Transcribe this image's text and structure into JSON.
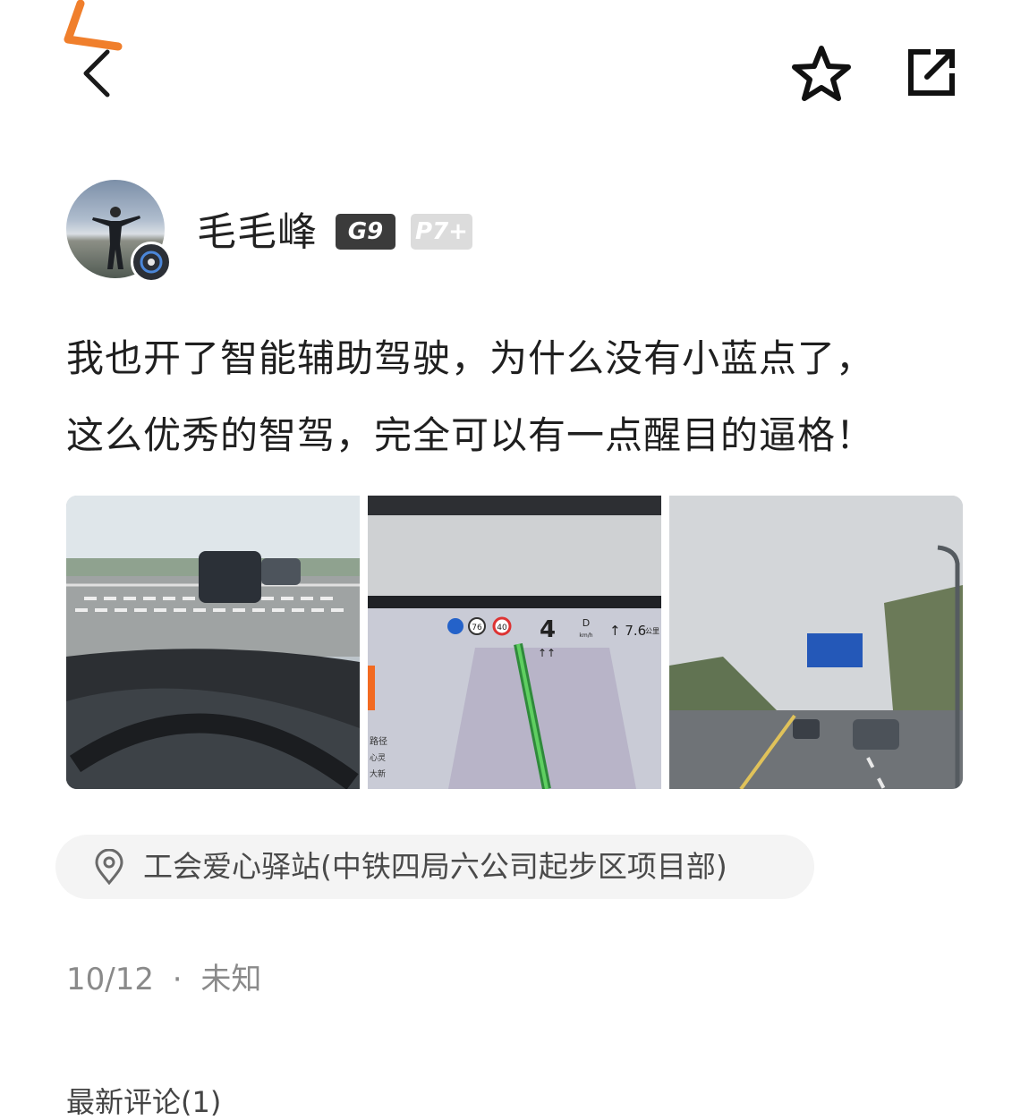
{
  "header": {
    "back_icon": "chevron-left-icon",
    "favorite_icon": "star-outline-icon",
    "share_icon": "share-external-icon",
    "annotation_color": "#f07f2c"
  },
  "author": {
    "name": "毛毛峰",
    "badges": [
      "G9",
      "P7+"
    ]
  },
  "post": {
    "text_line1": "我也开了智能辅助驾驶，为什么没有小蓝点了，",
    "text_line2": "这么优秀的智驾，完全可以有一点醒目的逼格！",
    "images": [
      {
        "label": "road-through-windshield"
      },
      {
        "label": "center-display-navigation",
        "speed": "4",
        "speed_limit_a": "76",
        "speed_limit_b": "40",
        "gear": "D",
        "gear_unit": "km/h",
        "distance": "7.6",
        "distance_unit": "公里",
        "side_text_1": "路径",
        "side_text_2": "心灵",
        "side_text_3": "大新"
      },
      {
        "label": "road-with-sign"
      }
    ],
    "location": "工会爱心驿站(中铁四局六公司起步区项目部)",
    "date": "10/12",
    "separator": "·",
    "region": "未知"
  },
  "comments": {
    "heading_partial": "最新评论(1)"
  }
}
